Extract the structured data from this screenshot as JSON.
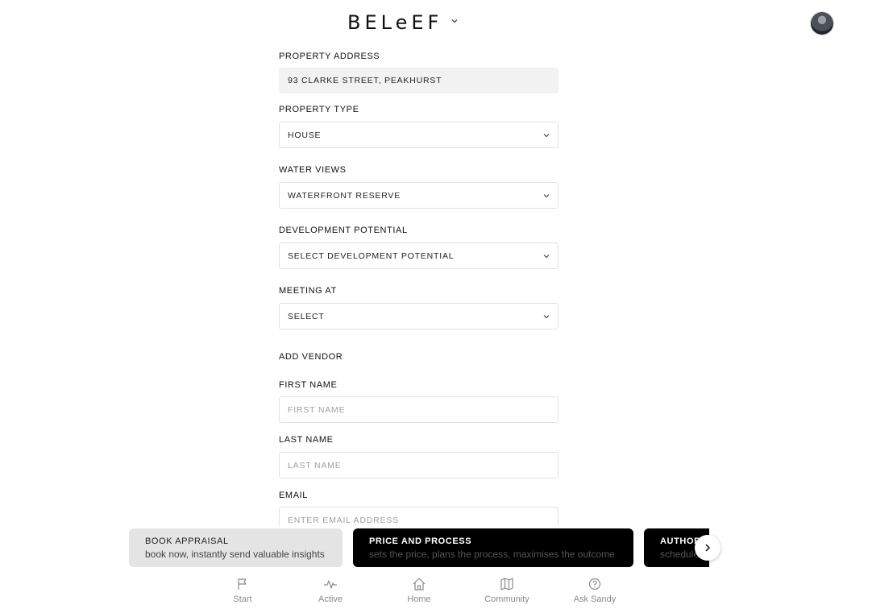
{
  "header": {
    "logo": "BELeEF"
  },
  "form": {
    "property_address": {
      "label": "PROPERTY ADDRESS",
      "value": "93 CLARKE STREET, PEAKHURST"
    },
    "property_type": {
      "label": "PROPERTY TYPE",
      "value": "HOUSE"
    },
    "water_views": {
      "label": "WATER VIEWS",
      "value": "WATERFRONT RESERVE"
    },
    "development_potential": {
      "label": "DEVELOPMENT POTENTIAL",
      "value": "SELECT DEVELOPMENT POTENTIAL"
    },
    "meeting_at": {
      "label": "MEETING AT",
      "value": "SELECT"
    },
    "add_vendor": {
      "heading": "ADD VENDOR"
    },
    "first_name": {
      "label": "FIRST NAME",
      "placeholder": "FIRST NAME",
      "value": ""
    },
    "last_name": {
      "label": "LAST NAME",
      "placeholder": "LAST NAME",
      "value": ""
    },
    "email": {
      "label": "EMAIL",
      "placeholder": "ENTER EMAIL ADDRESS",
      "value": ""
    }
  },
  "cards": [
    {
      "title": "BOOK APPRAISAL",
      "subtitle": "book now, instantly send valuable insights"
    },
    {
      "title": "PRICE AND PROCESS",
      "subtitle": "sets the price, plans the process, maximises the outcome"
    },
    {
      "title": "AUTHORITY",
      "subtitle": "schedule"
    }
  ],
  "nav": [
    {
      "label": "Start",
      "icon": "flag-icon"
    },
    {
      "label": "Active",
      "icon": "pulse-icon"
    },
    {
      "label": "Home",
      "icon": "home-icon"
    },
    {
      "label": "Community",
      "icon": "map-icon"
    },
    {
      "label": "Ask Sandy",
      "icon": "help-circle-icon"
    }
  ]
}
